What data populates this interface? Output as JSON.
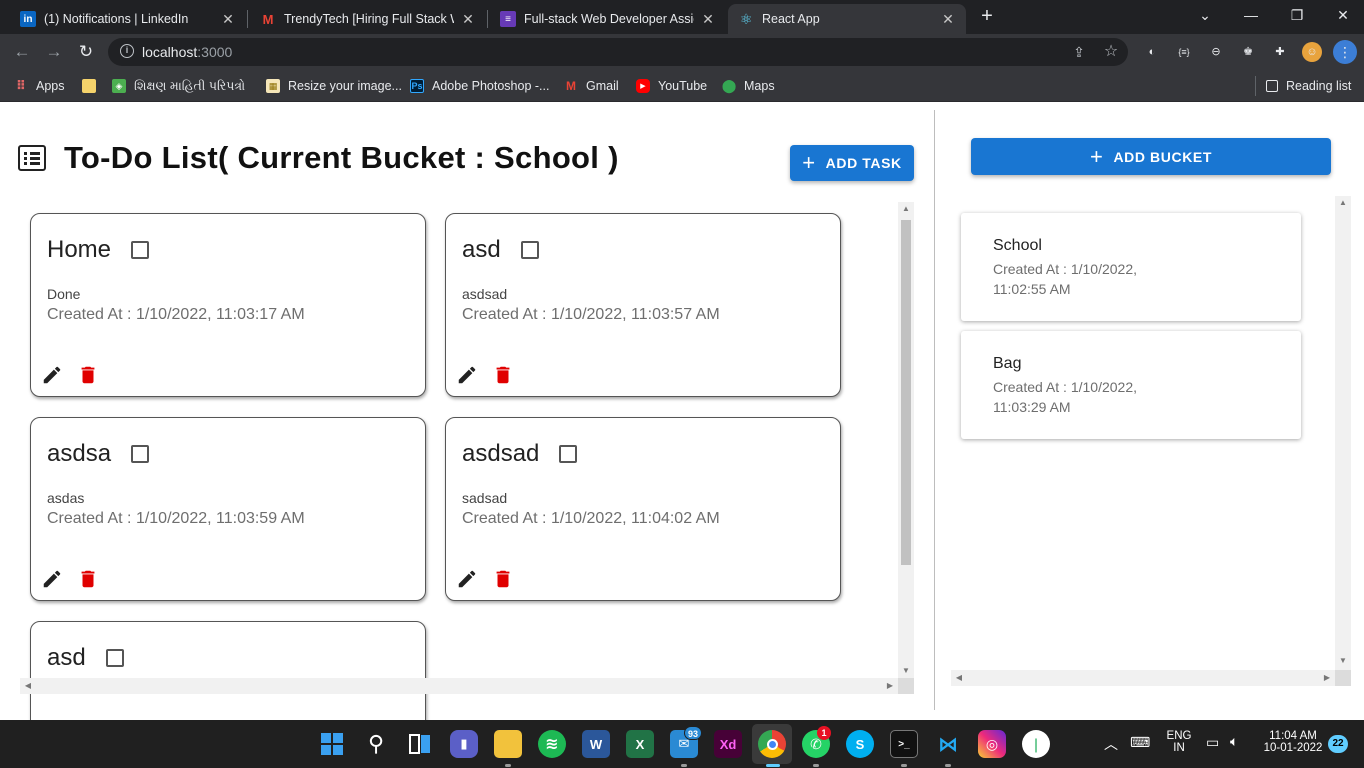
{
  "browser": {
    "tabs": [
      {
        "label": "(1) Notifications | LinkedIn",
        "favicon": "linkedin-icon",
        "color": "#0a66c2",
        "active": false
      },
      {
        "label": "TrendyTech [Hiring Full Stack Web",
        "favicon": "gmail-icon",
        "color": "#ea4335",
        "active": false
      },
      {
        "label": "Full-stack Web Developer Assign",
        "favicon": "forms-icon",
        "color": "#673ab7",
        "active": false
      },
      {
        "label": "React App",
        "favicon": "react-icon",
        "color": "#61dafb",
        "active": true
      }
    ],
    "url_host": "localhost",
    "url_port": ":3000",
    "bookmarks": [
      {
        "label": "Apps",
        "icon": "apps-grid-icon"
      },
      {
        "label": "",
        "icon": "folder-icon"
      },
      {
        "label": "શિક્ષણ માહિતી પરિપત્રો",
        "icon": "site-icon"
      },
      {
        "label": "Resize your image...",
        "icon": "resize-icon"
      },
      {
        "label": "Adobe Photoshop -...",
        "icon": "photoshop-icon"
      },
      {
        "label": "Gmail",
        "icon": "gmail-icon"
      },
      {
        "label": "YouTube",
        "icon": "youtube-icon"
      },
      {
        "label": "Maps",
        "icon": "maps-icon"
      }
    ],
    "reading_list": "Reading list"
  },
  "app": {
    "title": "To-Do List( Current Bucket : School )",
    "add_task_label": "ADD TASK",
    "add_bucket_label": "ADD BUCKET",
    "tasks": [
      {
        "title": "Home",
        "description": "Done",
        "created": "Created At : 1/10/2022, 11:03:17 AM"
      },
      {
        "title": "asd",
        "description": "asdsad",
        "created": "Created At : 1/10/2022, 11:03:57 AM"
      },
      {
        "title": "asdsa",
        "description": "asdas",
        "created": "Created At : 1/10/2022, 11:03:59 AM"
      },
      {
        "title": "asdsad",
        "description": "sadsad",
        "created": "Created At : 1/10/2022, 11:04:02 AM"
      },
      {
        "title": "asd",
        "description": "",
        "created": ""
      }
    ],
    "buckets": [
      {
        "name": "School",
        "created": "Created At : 1/10/2022, 11:02:55 AM"
      },
      {
        "name": "Bag",
        "created": "Created At : 1/10/2022, 11:03:29 AM"
      }
    ],
    "colors": {
      "primary": "#1976d2",
      "delete": "#e00000",
      "edit": "#222222"
    }
  },
  "taskbar": {
    "apps": [
      {
        "name": "start-icon"
      },
      {
        "name": "search-icon"
      },
      {
        "name": "task-view-icon"
      },
      {
        "name": "teams-chat-icon"
      },
      {
        "name": "file-explorer-icon"
      },
      {
        "name": "spotify-icon"
      },
      {
        "name": "word-icon"
      },
      {
        "name": "excel-icon"
      },
      {
        "name": "mail-icon",
        "badge": "93"
      },
      {
        "name": "adobe-xd-icon"
      },
      {
        "name": "chrome-icon"
      },
      {
        "name": "whatsapp-icon",
        "badge": "1"
      },
      {
        "name": "skype-icon"
      },
      {
        "name": "terminal-icon"
      },
      {
        "name": "vscode-icon"
      },
      {
        "name": "instagram-icon"
      },
      {
        "name": "mongodb-compass-icon"
      }
    ],
    "language_top": "ENG",
    "language_bottom": "IN",
    "time": "11:04 AM",
    "date": "10-01-2022",
    "notification_count": "22"
  }
}
